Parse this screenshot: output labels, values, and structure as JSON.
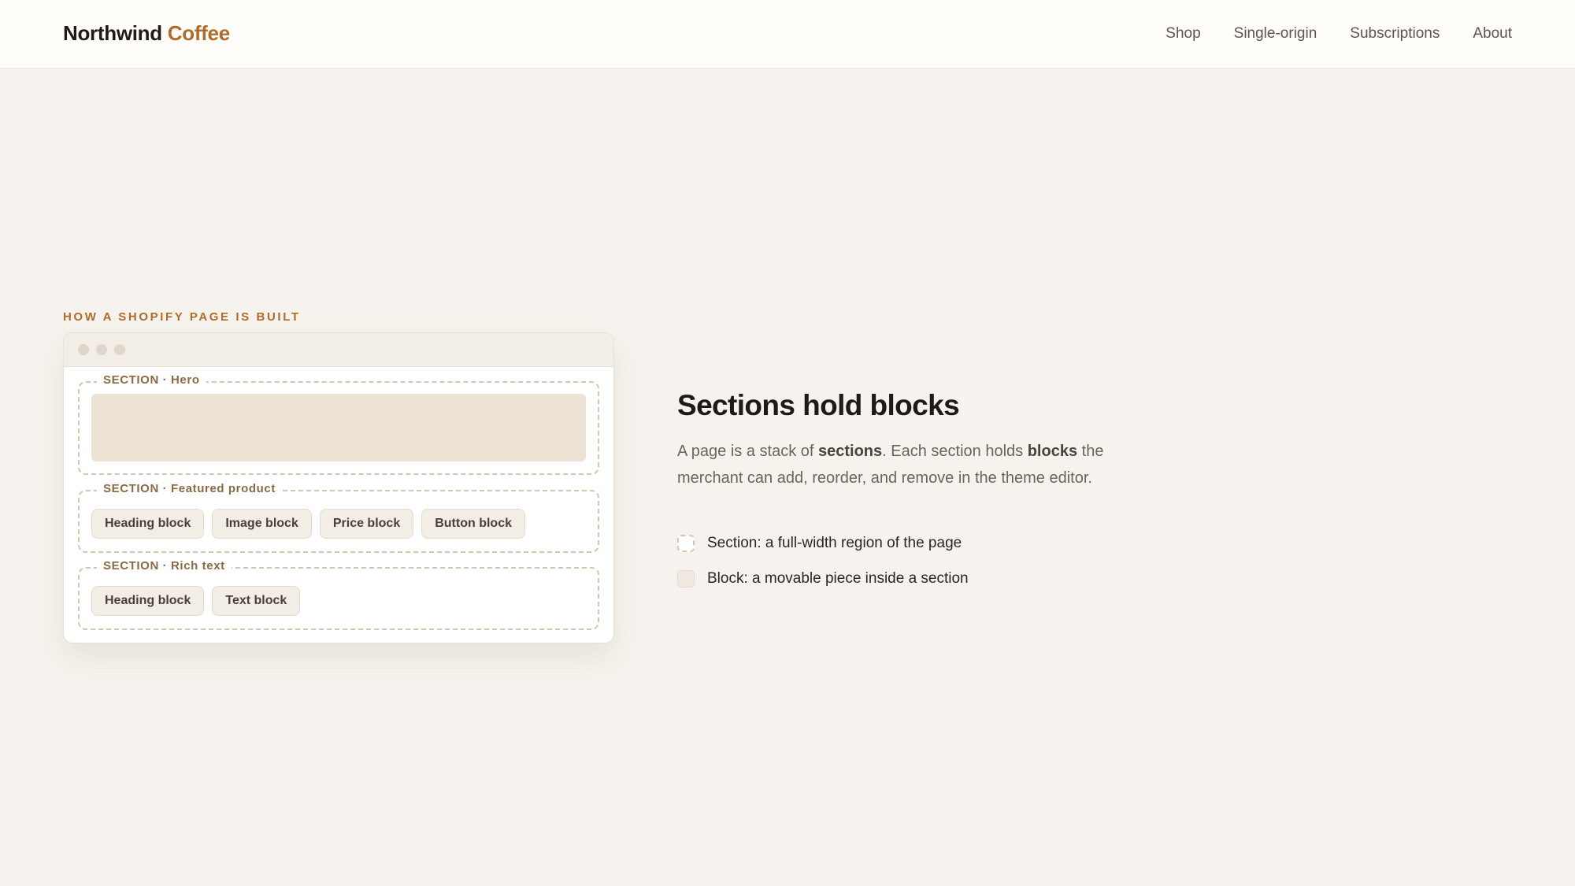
{
  "header": {
    "brand_primary": "Northwind",
    "brand_accent": "Coffee",
    "nav": [
      "Shop",
      "Single-origin",
      "Subscriptions",
      "About"
    ]
  },
  "illustration": {
    "eyebrow": "HOW A SHOPIFY PAGE IS BUILT",
    "sections": [
      {
        "label": "SECTION · Hero",
        "blocks": []
      },
      {
        "label": "SECTION · Featured product",
        "blocks": [
          "Heading block",
          "Image block",
          "Price block",
          "Button block"
        ]
      },
      {
        "label": "SECTION · Rich text",
        "blocks": [
          "Heading block",
          "Text block"
        ]
      }
    ]
  },
  "content": {
    "headline": "Sections hold blocks",
    "body_1": "A page is a stack of ",
    "body_bold_1": "sections",
    "body_2": ". Each section holds ",
    "body_bold_2": "blocks",
    "body_3": " the merchant can add, reorder, and remove in the theme editor.",
    "legend": [
      "Section: a full-width region of the page",
      "Block: a movable piece inside a section"
    ]
  },
  "colors": {
    "accent": "#b06a2a",
    "background": "#f6f3ee",
    "dashed_border": "#d4c6b2"
  }
}
